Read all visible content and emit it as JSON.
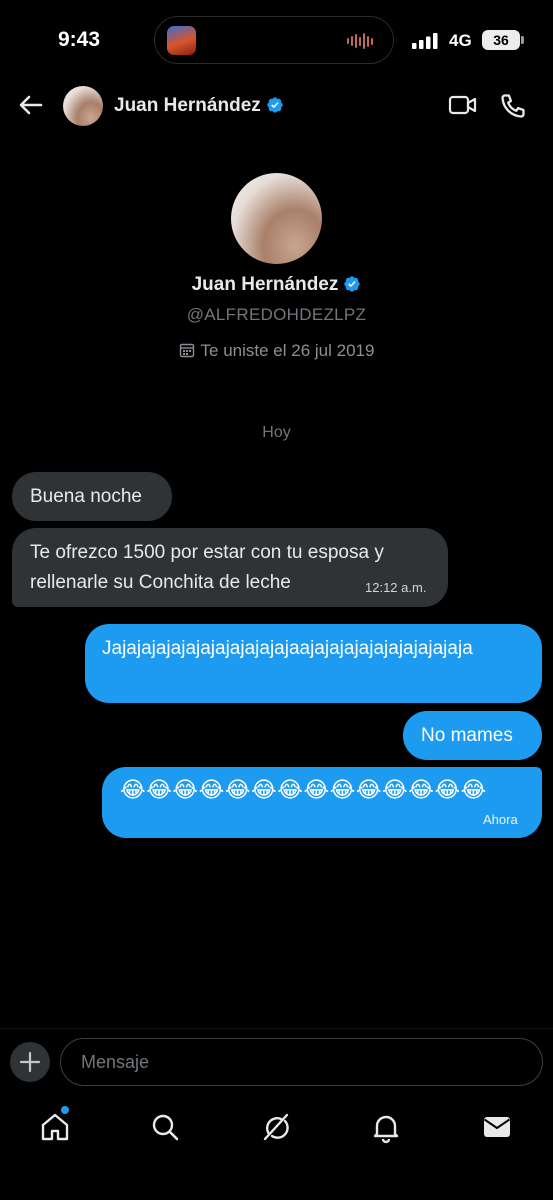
{
  "status_bar": {
    "time": "9:43",
    "network": "4G",
    "battery": "36"
  },
  "icons": {
    "back": "arrow-left-icon",
    "verified": "verified-badge-icon",
    "video": "video-camera-icon",
    "phone": "phone-icon",
    "calendar": "calendar-icon",
    "add": "plus-icon",
    "home": "home-icon",
    "search": "search-icon",
    "grok": "slash-circle-icon",
    "notifications": "bell-icon",
    "messages": "envelope-icon"
  },
  "colors": {
    "accent": "#1d9bf0",
    "incoming_bubble": "#2f3336",
    "background": "#000000"
  },
  "header": {
    "name": "Juan Hernández"
  },
  "profile": {
    "name": "Juan Hernández",
    "handle": "@ALFREDOHDEZLPZ",
    "joined": "Te uniste el 26 jul 2019"
  },
  "conversation": {
    "day_label": "Hoy",
    "messages": [
      {
        "direction": "in",
        "text": "Buena noche"
      },
      {
        "direction": "in",
        "text": "Te ofrezco 1500 por estar con tu esposa y rellenarle su Conchita de leche",
        "time": "12:12 a.m."
      },
      {
        "direction": "out",
        "text": "Jajajajajajajajajajajajajaajajajajajajajajajajaja"
      },
      {
        "direction": "out",
        "text": "No mames"
      },
      {
        "direction": "out",
        "text": "😂😂😂😂😂😂😂😂😂😂😂😂😂😂",
        "time": "Ahora"
      }
    ]
  },
  "composer": {
    "placeholder": "Mensaje"
  }
}
